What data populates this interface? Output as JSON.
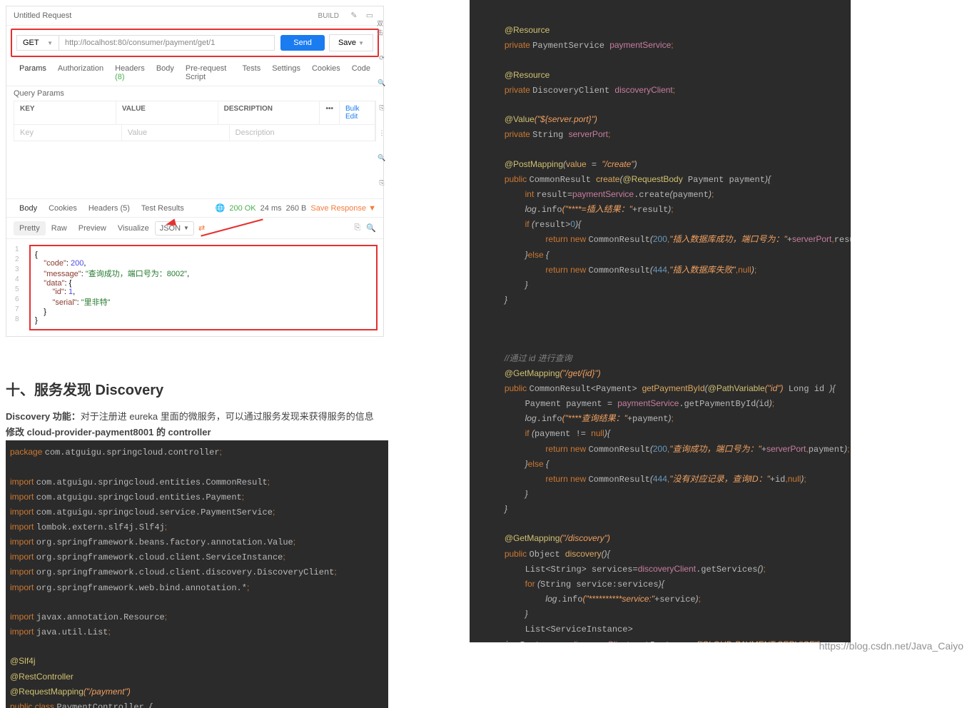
{
  "postman": {
    "title": "Untitled Request",
    "build": "BUILD",
    "method": "GET",
    "url": "http://localhost:80/consumer/payment/get/1",
    "send": "Send",
    "save": "Save",
    "tabs": {
      "params": "Params",
      "auth": "Authorization",
      "headers": "Headers",
      "headers_count": "(8)",
      "body": "Body",
      "prereq": "Pre-request Script",
      "tests": "Tests",
      "settings": "Settings",
      "cookies": "Cookies",
      "code": "Code"
    },
    "qp": "Query Params",
    "th": {
      "key": "KEY",
      "value": "VALUE",
      "desc": "DESCRIPTION",
      "bulk": "Bulk Edit"
    },
    "ph": {
      "key": "Key",
      "value": "Value",
      "desc": "Description"
    },
    "resp_tabs": {
      "body": "Body",
      "cookies": "Cookies",
      "headers": "Headers",
      "hcount": "(5)",
      "tests": "Test Results"
    },
    "status": {
      "code": "200 OK",
      "time": "24 ms",
      "size": "260 B",
      "save": "Save Response"
    },
    "view": {
      "pretty": "Pretty",
      "raw": "Raw",
      "preview": "Preview",
      "visualize": "Visualize",
      "json": "JSON"
    },
    "json": {
      "l1": "{",
      "l2_k": "\"code\"",
      "l2_v": "200",
      "l3_k": "\"message\"",
      "l3_v": "\"查询成功，端口号为：8002\"",
      "l4_k": "\"data\"",
      "l4_v": "{",
      "l5_k": "\"id\"",
      "l5_v": "1",
      "l6_k": "\"serial\"",
      "l6_v": "\"里非特\"",
      "l7": "}",
      "l8": "}"
    }
  },
  "section": {
    "heading": "十、服务发现 Discovery",
    "p1a": "Discovery 功能：",
    "p1b": "对于注册进 eureka 里面的微服务，可以通过服务发现来获得服务的信息",
    "p2": "修改 cloud-provider-payment8001 的 controller"
  },
  "code1": {
    "l1": "package com.atguigu.springcloud.controller;",
    "l2": "",
    "l3": "import com.atguigu.springcloud.entities.CommonResult;",
    "l4": "import com.atguigu.springcloud.entities.Payment;",
    "l5": "import com.atguigu.springcloud.service.PaymentService;",
    "l6": "import lombok.extern.slf4j.Slf4j;",
    "l7": "import org.springframework.beans.factory.annotation.Value;",
    "l8": "import org.springframework.cloud.client.ServiceInstance;",
    "l9": "import org.springframework.cloud.client.discovery.DiscoveryClient;",
    "l10": "import org.springframework.web.bind.annotation.*;",
    "l11": "",
    "l12": "import javax.annotation.Resource;",
    "l13": "import java.util.List;",
    "l14": "",
    "l15": "@Slf4j",
    "l16": "@RestController",
    "l17": "@RequestMapping(\"/payment\")",
    "l18": "public class PaymentController {"
  },
  "watermark": "https://blog.csdn.net/Java_Caiyo"
}
